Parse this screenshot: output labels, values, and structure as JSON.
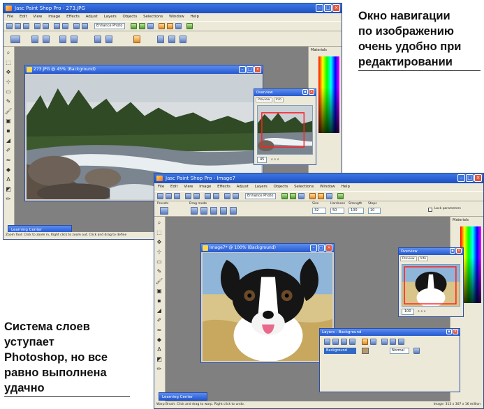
{
  "captions": {
    "top": [
      "Окно навигации",
      "по изображению",
      "очень удобно при",
      "редактировании"
    ],
    "bottom": [
      "Система слоев",
      "уступает",
      "Photoshop, но все",
      "равно выполнена",
      "удачно"
    ]
  },
  "app1": {
    "title": "Jasc Paint Shop Pro - 273.JPG",
    "menu": [
      "File",
      "Edit",
      "View",
      "Image",
      "Effects",
      "Adjust",
      "Layers",
      "Objects",
      "Selections",
      "Window",
      "Help"
    ],
    "enhance_label": "Enhance Photo",
    "image_window_title": "273.JPG @ 45% (Background)",
    "overview": {
      "title": "Overview",
      "tabs": [
        "Preview",
        "Info"
      ],
      "zoom": "45"
    },
    "panel_label": "Materials",
    "learning_center": "Learning Center",
    "status": "Zoom Tool: Click to zoom in, Right click to zoom out. Click and drag to define"
  },
  "app2": {
    "title": "Jasc Paint Shop Pro - Image7",
    "menu": [
      "File",
      "Edit",
      "View",
      "Image",
      "Effects",
      "Adjust",
      "Layers",
      "Objects",
      "Selections",
      "Window",
      "Help"
    ],
    "enhance_label": "Enhance Photo",
    "tool_options": {
      "presets": "Presets",
      "drag_mode": "Drag mode",
      "size_label": "Size",
      "size": "32",
      "hardness_label": "Hardness",
      "hardness": "50",
      "strength_label": "Strength",
      "strength": "100",
      "steps_label": "Steps",
      "steps": "10",
      "lock_label": "Lock parameters"
    },
    "image_window_title": "Image7* @ 100% (Background)",
    "overview": {
      "title": "Overview",
      "tabs": [
        "Preview",
        "Info"
      ],
      "zoom": "100"
    },
    "layers": {
      "title": "Layers - Background",
      "layer_name": "Background",
      "blend": "Normal"
    },
    "panel_label": "Materials",
    "learning_center": "Learning Center",
    "status": "Warp Brush: Click and drag to warp. Right click to undo.",
    "status_right": "Image: 313 x 307 x 16 million"
  }
}
